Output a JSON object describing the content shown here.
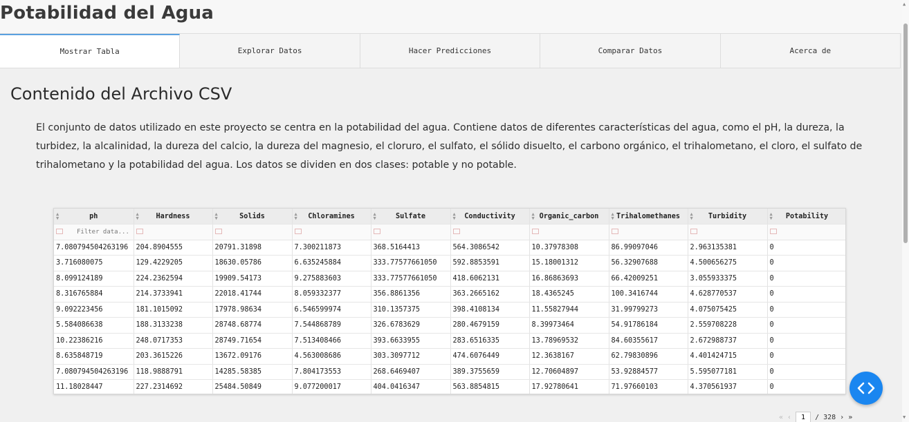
{
  "app": {
    "title": "Potabilidad del Agua"
  },
  "tabs": [
    {
      "label": "Mostrar Tabla",
      "active": true
    },
    {
      "label": "Explorar Datos",
      "active": false
    },
    {
      "label": "Hacer Predicciones",
      "active": false
    },
    {
      "label": "Comparar Datos",
      "active": false
    },
    {
      "label": "Acerca de",
      "active": false
    }
  ],
  "section": {
    "title": "Contenido del Archivo CSV",
    "description": "El conjunto de datos utilizado en este proyecto se centra en la potabilidad del agua. Contiene datos de diferentes características del agua, como el pH, la dureza, la turbidez, la alcalinidad, la dureza del calcio, la dureza del magnesio, el cloruro, el sulfato, el sólido disuelto, el carbono orgánico, el trihalometano, el cloro, el sulfato de trihalometano y la potabilidad del agua. Los datos se dividen en dos clases: potable y no potable."
  },
  "table": {
    "columns": [
      "ph",
      "Hardness",
      "Solids",
      "Chloramines",
      "Sulfate",
      "Conductivity",
      "Organic_carbon",
      "Trihalomethanes",
      "Turbidity",
      "Potability"
    ],
    "filter_placeholder": "Filter data...",
    "rows": [
      [
        "7.080794504263196",
        "204.8904555",
        "20791.31898",
        "7.300211873",
        "368.5164413",
        "564.3086542",
        "10.37978308",
        "86.99097046",
        "2.963135381",
        "0"
      ],
      [
        "3.716080075",
        "129.4229205",
        "18630.05786",
        "6.635245884",
        "333.77577661050",
        "592.8853591",
        "15.18001312",
        "56.32907688",
        "4.500656275",
        "0"
      ],
      [
        "8.099124189",
        "224.2362594",
        "19909.54173",
        "9.275883603",
        "333.77577661050",
        "418.6062131",
        "16.86863693",
        "66.42009251",
        "3.055933375",
        "0"
      ],
      [
        "8.316765884",
        "214.3733941",
        "22018.41744",
        "8.059332377",
        "356.8861356",
        "363.2665162",
        "18.4365245",
        "100.3416744",
        "4.628770537",
        "0"
      ],
      [
        "9.092223456",
        "181.1015092",
        "17978.98634",
        "6.546599974",
        "310.1357375",
        "398.4108134",
        "11.55827944",
        "31.99799273",
        "4.075075425",
        "0"
      ],
      [
        "5.584086638",
        "188.3133238",
        "28748.68774",
        "7.544868789",
        "326.6783629",
        "280.4679159",
        "8.39973464",
        "54.91786184",
        "2.559708228",
        "0"
      ],
      [
        "10.22386216",
        "248.0717353",
        "28749.71654",
        "7.513408466",
        "393.6633955",
        "283.6516335",
        "13.78969532",
        "84.60355617",
        "2.672988737",
        "0"
      ],
      [
        "8.635848719",
        "203.3615226",
        "13672.09176",
        "4.563008686",
        "303.3097712",
        "474.6076449",
        "12.3638167",
        "62.79830896",
        "4.401424715",
        "0"
      ],
      [
        "7.080794504263196",
        "118.9888791",
        "14285.58385",
        "7.804173553",
        "268.6469407",
        "389.3755659",
        "12.70604897",
        "53.92884577",
        "5.595077181",
        "0"
      ],
      [
        "11.18028447",
        "227.2314692",
        "25484.50849",
        "9.077200017",
        "404.0416347",
        "563.8854815",
        "17.92780641",
        "71.97660103",
        "4.370561937",
        "0"
      ]
    ]
  },
  "pagination": {
    "first": "«",
    "prev": "‹",
    "current_page": "1",
    "separator": "/",
    "total_pages": "328",
    "next": "›",
    "last": "»"
  },
  "icons": {
    "fab": "code-icon",
    "accent_color": "#1a86f0"
  }
}
